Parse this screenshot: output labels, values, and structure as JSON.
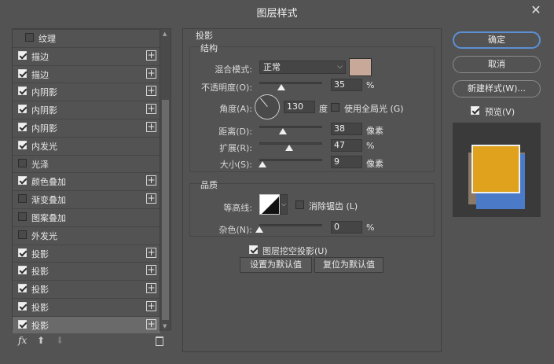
{
  "window": {
    "title": "图层样式"
  },
  "styles": [
    {
      "label": "纹理",
      "checked": false,
      "plus": false
    },
    {
      "label": "描边",
      "checked": true,
      "plus": true
    },
    {
      "label": "描边",
      "checked": true,
      "plus": true
    },
    {
      "label": "内阴影",
      "checked": true,
      "plus": true
    },
    {
      "label": "内阴影",
      "checked": true,
      "plus": true
    },
    {
      "label": "内阴影",
      "checked": true,
      "plus": true
    },
    {
      "label": "内发光",
      "checked": true,
      "plus": false
    },
    {
      "label": "光泽",
      "checked": false,
      "plus": false
    },
    {
      "label": "颜色叠加",
      "checked": true,
      "plus": true
    },
    {
      "label": "渐变叠加",
      "checked": false,
      "plus": true
    },
    {
      "label": "图案叠加",
      "checked": false,
      "plus": false
    },
    {
      "label": "外发光",
      "checked": false,
      "plus": false
    },
    {
      "label": "投影",
      "checked": true,
      "plus": true
    },
    {
      "label": "投影",
      "checked": true,
      "plus": true
    },
    {
      "label": "投影",
      "checked": true,
      "plus": true
    },
    {
      "label": "投影",
      "checked": true,
      "plus": true
    },
    {
      "label": "投影",
      "checked": true,
      "plus": true,
      "selected": true
    }
  ],
  "footer": {
    "fx": "fx"
  },
  "drop_shadow": {
    "title": "投影",
    "structure": {
      "title": "结构",
      "blend_mode_label": "混合模式:",
      "blend_mode_value": "正常",
      "shadow_color": "#c8a898",
      "opacity_label": "不透明度(O):",
      "opacity_value": "35",
      "opacity_unit": "%",
      "opacity_level": 0.35,
      "angle_label": "角度(A):",
      "angle_value": "130",
      "angle_unit": "度",
      "global_light_label": "使用全局光 (G)",
      "global_light_checked": false,
      "distance_label": "距离(D):",
      "distance_value": "38",
      "distance_unit": "像素",
      "distance_level": 0.38,
      "spread_label": "扩展(R):",
      "spread_value": "47",
      "spread_unit": "%",
      "spread_level": 0.47,
      "size_label": "大小(S):",
      "size_value": "9",
      "size_unit": "像素",
      "size_level": 0.05
    },
    "quality": {
      "title": "品质",
      "contour_label": "等高线:",
      "anti_alias_label": "消除锯齿 (L)",
      "anti_alias_checked": false,
      "noise_label": "杂色(N):",
      "noise_value": "0",
      "noise_unit": "%",
      "noise_level": 0
    },
    "knockout_label": "图层挖空投影(U)",
    "knockout_checked": true,
    "make_default_label": "设置为默认值",
    "reset_default_label": "复位为默认值"
  },
  "actions": {
    "ok_label": "确定",
    "cancel_label": "取消",
    "new_style_label": "新建样式(W)...",
    "preview_label": "预览(V)",
    "preview_checked": true
  },
  "preview_colors": {
    "top": "#e0a21c",
    "blue": "#4a7ac8",
    "taupe": "#8a7868"
  }
}
